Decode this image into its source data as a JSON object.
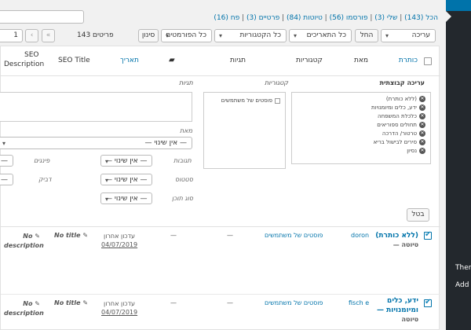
{
  "search": {
    "value": ""
  },
  "views": {
    "all": "הכל (143)",
    "mine": "שלי (3)",
    "published": "פורסמו (56)",
    "drafts": "טיוטות (84)",
    "private": "פרטיים (3)",
    "trash": "פח (16)",
    "sep": " | "
  },
  "filters": {
    "bulk_action": "עריכה",
    "apply_btn": "החל",
    "dates": "כל התאריכים",
    "categories": "כל הקטגוריות",
    "formats": "כל הפורמטים",
    "filter_btn": "סינון"
  },
  "pagination": {
    "count": "143 פריטים",
    "first": "«",
    "prev": "‹",
    "current": "1"
  },
  "columns": {
    "title": "כותרת",
    "author": "מאת",
    "categories": "קטגוריות",
    "tags": "תגיות",
    "date": "תאריך",
    "seo_title": "SEO Title",
    "seo_desc_1": "SEO",
    "seo_desc_2": "Description"
  },
  "quick_edit": {
    "bulk_title": "עריכה קבוצתית",
    "categories_title": "קטגוריות",
    "tags_title": "תגיות",
    "posts": [
      "(ללא כותרת)",
      "ידע, כלים ומיומנויות",
      "כלכלת המשפחה",
      "תחולים ספוריאים",
      "טרטור/ הדרכה",
      "סירים לבישול בריא",
      "נסיון"
    ],
    "category_option": "פוסטים של משתמשים",
    "author_label": "מאת",
    "author_value": "— אין שינוי —",
    "comments_label": "תגובות",
    "comments_value": "— אין שינוי —",
    "pings_label": "פינגים",
    "status_label": "סטטוס",
    "status_value": "— אין שינוי —",
    "sticky_label": "דביק",
    "format_label": "סוג תוכן",
    "format_value": "— אין שינוי —",
    "dash_small": "—",
    "cancel_btn": "בטל"
  },
  "rows": [
    {
      "title_1": "(ללא כותרת)",
      "title_2": "— טיוטה",
      "author": "doron",
      "category": "פוסטים של משתמשים",
      "tags": "—",
      "date_status": "עדכון אחרון",
      "date": "04/07/2019",
      "seo_title": "No title",
      "seo_desc_1": "No",
      "seo_desc_2": "description"
    },
    {
      "title_1": "ידע, כלים",
      "title_2": "ומיומנויות —",
      "title_3": "טיוטה",
      "author": "fisch e",
      "category": "פוסטים של משתמשים",
      "tags": "—",
      "date_status": "עדכון אחרון",
      "date": "04/07/2019",
      "seo_title": "No title",
      "seo_desc_1": "No",
      "seo_desc_2": "description"
    }
  ],
  "side": {
    "text_1": "Ther",
    "text_2": "Add C"
  }
}
